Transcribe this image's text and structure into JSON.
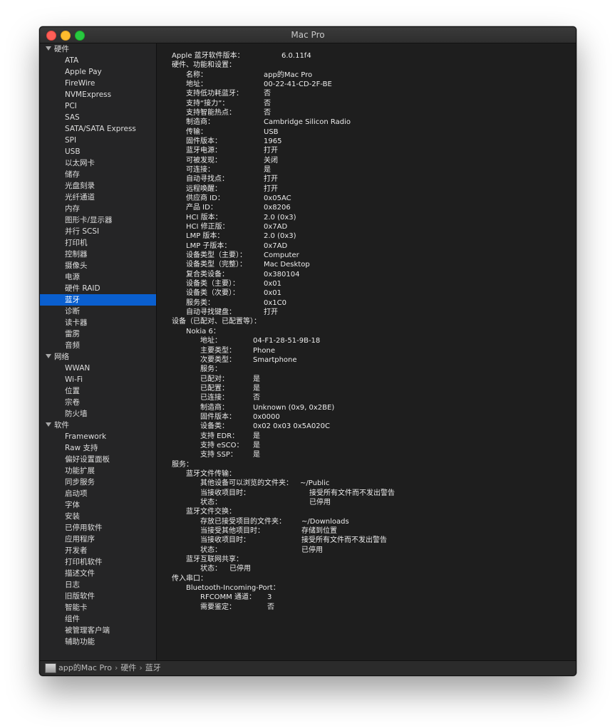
{
  "window": {
    "title": "Mac Pro"
  },
  "sidebar": {
    "categories": [
      {
        "label": "硬件",
        "items": [
          "ATA",
          "Apple Pay",
          "FireWire",
          "NVMExpress",
          "PCI",
          "SAS",
          "SATA/SATA Express",
          "SPI",
          "USB",
          "以太网卡",
          "储存",
          "光盘刻录",
          "光纤通道",
          "内存",
          "图形卡/显示器",
          "并行 SCSI",
          "打印机",
          "控制器",
          "摄像头",
          "电源",
          "硬件 RAID",
          "蓝牙",
          "诊断",
          "读卡器",
          "雷雳",
          "音频"
        ]
      },
      {
        "label": "网络",
        "items": [
          "WWAN",
          "Wi-Fi",
          "位置",
          "宗卷",
          "防火墙"
        ]
      },
      {
        "label": "软件",
        "items": [
          "Framework",
          "Raw 支持",
          "偏好设置面板",
          "功能扩展",
          "同步服务",
          "启动项",
          "字体",
          "安装",
          "已停用软件",
          "应用程序",
          "开发者",
          "打印机软件",
          "描述文件",
          "日志",
          "旧版软件",
          "智能卡",
          "组件",
          "被管理客户端",
          "辅助功能"
        ]
      }
    ],
    "selected": "蓝牙"
  },
  "detail": {
    "lines": [
      [
        "Apple 蓝牙软件版本：",
        "6.0.11f4"
      ],
      [
        "硬件、功能和设置：",
        ""
      ],
      [
        "名称：",
        "app的Mac Pro"
      ],
      [
        "地址：",
        "00-22-41-CD-2F-BE"
      ],
      [
        "支持低功耗蓝牙：",
        "否"
      ],
      [
        "支持“接力”：",
        "否"
      ],
      [
        "支持智能热点：",
        "否"
      ],
      [
        "制造商：",
        "Cambridge Silicon Radio"
      ],
      [
        "传输：",
        "USB"
      ],
      [
        "固件版本：",
        "1965"
      ],
      [
        "蓝牙电源：",
        "打开"
      ],
      [
        "可被发现：",
        "关闭"
      ],
      [
        "可连接：",
        "是"
      ],
      [
        "自动寻找点：",
        "打开"
      ],
      [
        "远程唤醒：",
        "打开"
      ],
      [
        "供应商 ID：",
        "0x05AC"
      ],
      [
        "产品 ID：",
        "0x8206"
      ],
      [
        "HCI 版本：",
        "2.0 (0x3)"
      ],
      [
        "HCI 修正版：",
        "0x7AD"
      ],
      [
        "LMP 版本：",
        "2.0 (0x3)"
      ],
      [
        "LMP 子版本：",
        "0x7AD"
      ],
      [
        "设备类型（主要）：",
        "Computer"
      ],
      [
        "设备类型（完整）：",
        "Mac Desktop"
      ],
      [
        "复合类设备：",
        "0x380104"
      ],
      [
        "设备类（主要）：",
        "0x01"
      ],
      [
        "设备类（次要）：",
        "0x01"
      ],
      [
        "服务类：",
        "0x1C0"
      ],
      [
        "自动寻找键盘：",
        "打开"
      ],
      [
        "设备（已配对、已配置等）：",
        ""
      ],
      [
        "Nokia 6：",
        ""
      ],
      [
        "地址：",
        "04-F1-28-51-9B-18"
      ],
      [
        "主要类型：",
        "Phone"
      ],
      [
        "次要类型：",
        "Smartphone"
      ],
      [
        "服务：",
        ""
      ],
      [
        "已配对：",
        "是"
      ],
      [
        "已配置：",
        "是"
      ],
      [
        "已连接：",
        "否"
      ],
      [
        "制造商：",
        "Unknown (0x9, 0x2BE)"
      ],
      [
        "固件版本：",
        "0x0000"
      ],
      [
        "设备类：",
        "0x02 0x03 0x5A020C"
      ],
      [
        "支持 EDR：",
        "是"
      ],
      [
        "支持 eSCO：",
        "是"
      ],
      [
        "支持 SSP：",
        "是"
      ],
      [
        "服务：",
        ""
      ],
      [
        "蓝牙文件传输：",
        ""
      ],
      [
        "其他设备可以浏览的文件夹：",
        "~/Public"
      ],
      [
        "当接收项目时：",
        "接受所有文件而不发出警告"
      ],
      [
        "状态：",
        "已停用"
      ],
      [
        "蓝牙文件交换：",
        ""
      ],
      [
        "存放已接受项目的文件夹：",
        "~/Downloads"
      ],
      [
        "当接受其他项目时：",
        "存储到位置"
      ],
      [
        "当接收项目时：",
        "接受所有文件而不发出警告"
      ],
      [
        "状态：",
        "已停用"
      ],
      [
        "蓝牙互联网共享：",
        ""
      ],
      [
        "状态：",
        "已停用"
      ],
      [
        "传入串口：",
        ""
      ],
      [
        "Bluetooth-Incoming-Port：",
        ""
      ],
      [
        "RFCOMM 通道：",
        "3"
      ],
      [
        "需要鉴定：",
        "否"
      ]
    ]
  },
  "statusbar": {
    "crumbs": [
      "app的Mac Pro",
      "硬件",
      "蓝牙"
    ],
    "separator": "›"
  },
  "icons": {
    "traffic": [
      "close-icon",
      "minimize-icon",
      "zoom-icon"
    ],
    "status": "computer-icon",
    "category": "disclosure-triangle-icon"
  },
  "colors": {
    "selection": "#0a5fcf",
    "background": "#1e1e1e"
  }
}
